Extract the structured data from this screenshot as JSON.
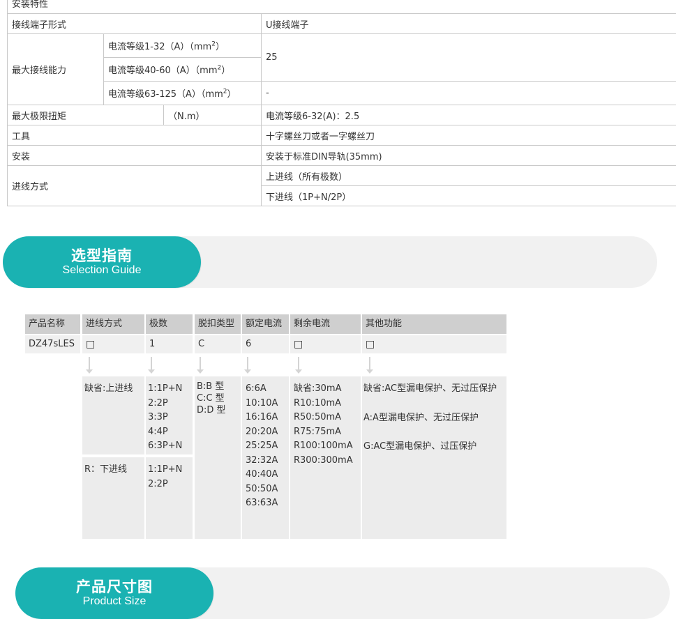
{
  "spec_table": {
    "install_features": "安装特性",
    "terminal_form_label": "接线端子形式",
    "terminal_form_value": "U接线端子",
    "max_wiring_label": "最大接线能力",
    "wiring_rows": [
      {
        "label": "电流等级1-32（A）（mm",
        "sup": "2",
        "close": "）"
      },
      {
        "label": "电流等级40-60（A）（mm",
        "sup": "2",
        "close": "）"
      },
      {
        "label": "电流等级63-125（A）（mm",
        "sup": "2",
        "close": "）"
      }
    ],
    "wiring_value_1": "25",
    "wiring_value_2": "-",
    "torque_label": "最大极限扭矩",
    "torque_unit": "（N.m）",
    "torque_value": "电流等级6-32(A)：2.5",
    "tool_label": "工具",
    "tool_value": "十字螺丝刀或者一字螺丝刀",
    "mount_label": "安装",
    "mount_value": "安装于标准DIN导轨(35mm)",
    "feed_label": "进线方式",
    "feed_value_1": "上进线（所有极数）",
    "feed_value_2": "下进线（1P+N/2P）"
  },
  "banners": {
    "selection": {
      "cn": "选型指南",
      "en": "Selection Guide"
    },
    "size": {
      "cn": "产品尺寸图",
      "en": "Product Size"
    }
  },
  "guide": {
    "headers": [
      "产品名称",
      "进线方式",
      "极数",
      "脱扣类型",
      "额定电流",
      "剩余电流",
      "其他功能"
    ],
    "values": [
      "DZ47sLES",
      "□",
      "1",
      "C",
      "6",
      "□",
      "□"
    ],
    "feed_options": [
      "缺省:上进线",
      "R：下进线"
    ],
    "poles_top": [
      "1:1P+N",
      "2:2P",
      "3:3P",
      "4:4P",
      "6:3P+N"
    ],
    "poles_bottom": [
      "1:1P+N",
      "2:2P"
    ],
    "trip_types": [
      "B:B 型",
      "C:C 型",
      "D:D 型"
    ],
    "rated_currents": [
      "6:6A",
      "10:10A",
      "16:16A",
      "20:20A",
      "25:25A",
      "32:32A",
      "40:40A",
      "50:50A",
      "63:63A"
    ],
    "residual_currents": [
      "缺省:30mA",
      "R10:10mA",
      "R50:50mA",
      "R75:75mA",
      "R100:100mA",
      "R300:300mA"
    ],
    "other_functions": [
      "缺省:AC型漏电保护、无过压保护",
      "A:A型漏电保护、无过压保护",
      "G:AC型漏电保护、过压保护"
    ]
  },
  "colors": {
    "teal_accent": "#1ab2b2",
    "header_gray": "#cfcfcf",
    "row_gray": "#f0f0f0",
    "body_gray": "#ececec",
    "track_gray": "#f1f1f1"
  }
}
